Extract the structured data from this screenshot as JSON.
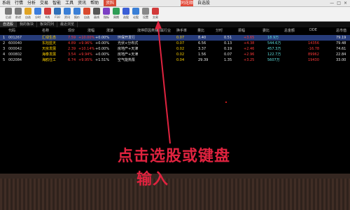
{
  "titlebar": {
    "menus": [
      "系统",
      "行情",
      "分析",
      "交易",
      "智能",
      "工具",
      "资讯",
      "帮助"
    ],
    "hot_menu": "资料",
    "logo": "同花顺",
    "title": "自选股",
    "winbtns": [
      "—",
      "□",
      "×"
    ]
  },
  "toolbar": {
    "items": [
      {
        "label": "后退",
        "icon": "back-icon",
        "color": "#7a7a7a"
      },
      {
        "label": "前进",
        "icon": "forward-icon",
        "color": "#7a7a7a"
      },
      {
        "label": "自选",
        "icon": "star-icon",
        "color": "#e0a324"
      },
      {
        "label": "分时",
        "icon": "timechart-icon",
        "color": "#3c7ddc"
      },
      {
        "label": "K线",
        "icon": "kline-icon",
        "color": "#d23a3a"
      },
      {
        "label": "F10",
        "icon": "f10-icon",
        "color": "#2f6fb8"
      },
      {
        "label": "资讯",
        "icon": "news-icon",
        "color": "#3a7fd6"
      },
      {
        "label": "报价",
        "icon": "quote-icon",
        "color": "#3a7fd6"
      },
      {
        "label": "自选",
        "icon": "bookmark-icon",
        "color": "#d94a2e"
      },
      {
        "label": "画线",
        "icon": "draw-icon",
        "color": "#555"
      },
      {
        "label": "指标",
        "icon": "indicator-icon",
        "color": "#7b3fc4"
      },
      {
        "label": "周期",
        "icon": "cycle-icon",
        "color": "#2e9d55"
      },
      {
        "label": "选股",
        "icon": "stock-picker-icon",
        "color": "#3a5ed6"
      },
      {
        "label": "论股",
        "icon": "discuss-icon",
        "color": "#3a7fd6"
      },
      {
        "label": "设置",
        "icon": "settings-icon",
        "color": "#888"
      },
      {
        "label": "交易",
        "icon": "trade-icon",
        "color": "#d23a3a"
      }
    ]
  },
  "tabs": [
    "自选股",
    "我的板块",
    "板块同列",
    "最近浏览"
  ],
  "active_tab": 0,
  "subtabs": [
    "我的板块",
    "板块同列",
    "最近浏览"
  ],
  "table": {
    "headers": [
      "代码",
      "名称",
      "现价",
      "涨幅",
      "涨速",
      "涨停原因类别",
      "所属行业",
      "换手率",
      "量比",
      "分时",
      "振幅",
      "委比",
      "总金额",
      "DDE",
      "总市值"
    ],
    "rows": [
      {
        "idx": "1",
        "code": "001267",
        "name": "汇绿生态",
        "price": "7.59",
        "change": "+10.00%",
        "speed": "+0.00%",
        "reason": "环保开发行",
        "industry": "",
        "a": "0.07",
        "b": "8.40",
        "c": "0.51",
        "d": "+3.65",
        "e": "18.9万",
        "f": "",
        "g": "79.19"
      },
      {
        "idx": "2",
        "code": "600040",
        "name": "东旭蓝天",
        "price": "4.89",
        "change": "+9.96%",
        "speed": "+0.00%",
        "reason": "光伏+分布式",
        "industry": "",
        "a": "0.07",
        "b": "6.56",
        "c": "0.13",
        "d": "+4.38",
        "e": "544.6万",
        "f": "14356",
        "g": "79.48"
      },
      {
        "idx": "3",
        "code": "000042",
        "name": "天房发展",
        "price": "2.39",
        "change": "+10.14%",
        "speed": "+0.00%",
        "reason": "房地产+天津",
        "industry": "",
        "a": "0.02",
        "b": "3.37",
        "c": "0.19",
        "d": "+2.46",
        "e": "457.3万",
        "f": "-16.78",
        "g": "74.61"
      },
      {
        "idx": "4",
        "code": "000802",
        "name": "海泰发展",
        "price": "3.54",
        "change": "+9.94%",
        "speed": "+0.00%",
        "reason": "房地产+天津",
        "industry": "",
        "a": "0.02",
        "b": "1.56",
        "c": "0.07",
        "d": "+2.96",
        "e": "122.7万",
        "f": "89962",
        "g": "22.84"
      },
      {
        "idx": "5",
        "code": "002084",
        "name": "海鸥住工",
        "price": "6.74",
        "change": "+9.95%",
        "speed": "+1.51%",
        "reason": "空气能热泵",
        "industry": "",
        "a": "0.04",
        "b": "29.39",
        "c": "1.35",
        "d": "+3.25",
        "e": "5607万",
        "f": "19430",
        "g": "33.00"
      }
    ]
  },
  "annotation": {
    "line1": "点击选股或键盘",
    "line2": "输入",
    "arrow_color": "#e0233f"
  }
}
